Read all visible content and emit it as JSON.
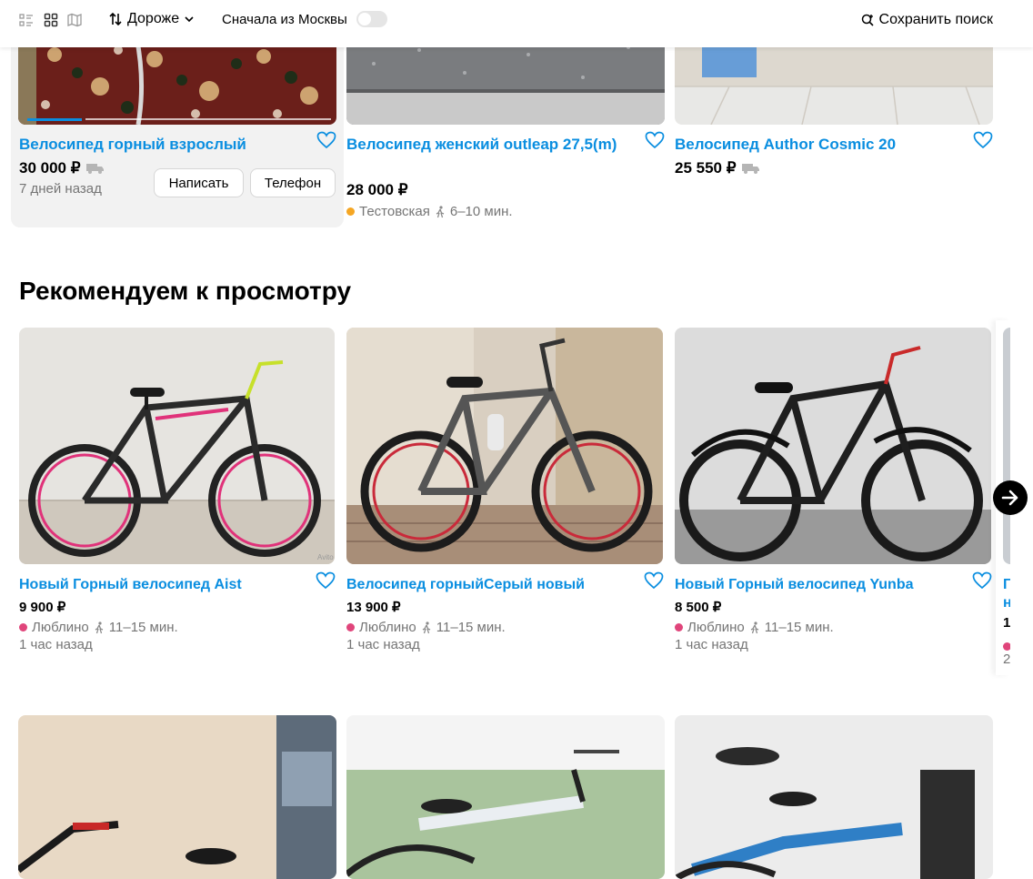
{
  "toolbar": {
    "sort_label": "Дороже",
    "moscow_label": "Сначала из Москвы",
    "save_search_label": "Сохранить поиск"
  },
  "top_listings": [
    {
      "title": "Велосипед горный взрослый",
      "price": "30 000 ₽",
      "date": "7 дней назад",
      "write_label": "Написать",
      "phone_label": "Телефон"
    },
    {
      "title": "Велосипед женский outleap 27,5(m)",
      "price": "28 000 ₽",
      "station": "Тестовская",
      "walk": "6–10 мин.",
      "station_color": "#f5a623"
    },
    {
      "title": "Велосипед Author Cosmic 20",
      "price": "25 550 ₽"
    }
  ],
  "recommended": {
    "heading": "Рекомендуем к просмотру",
    "items": [
      {
        "title": "Новый Горный велосипед Aist",
        "price": "9 900 ₽",
        "station": "Люблино",
        "walk": "11–15 мин.",
        "date": "1 час назад",
        "station_color": "#e0457b"
      },
      {
        "title": "Велосипед горныйСерый новый",
        "price": "13 900 ₽",
        "station": "Люблино",
        "walk": "11–15 мин.",
        "date": "1 час назад",
        "station_color": "#e0457b"
      },
      {
        "title": "Новый Горный велосипед Yunba",
        "price": "8 500 ₽",
        "station": "Люблино",
        "walk": "11–15 мин.",
        "date": "1 час назад",
        "station_color": "#e0457b"
      }
    ],
    "partial": {
      "title_a": "Г",
      "title_b": "н",
      "price": "1",
      "date": "2"
    }
  },
  "colors": {
    "accent": "#0a8ee0",
    "card_active_bg": "#f2f2f2"
  }
}
